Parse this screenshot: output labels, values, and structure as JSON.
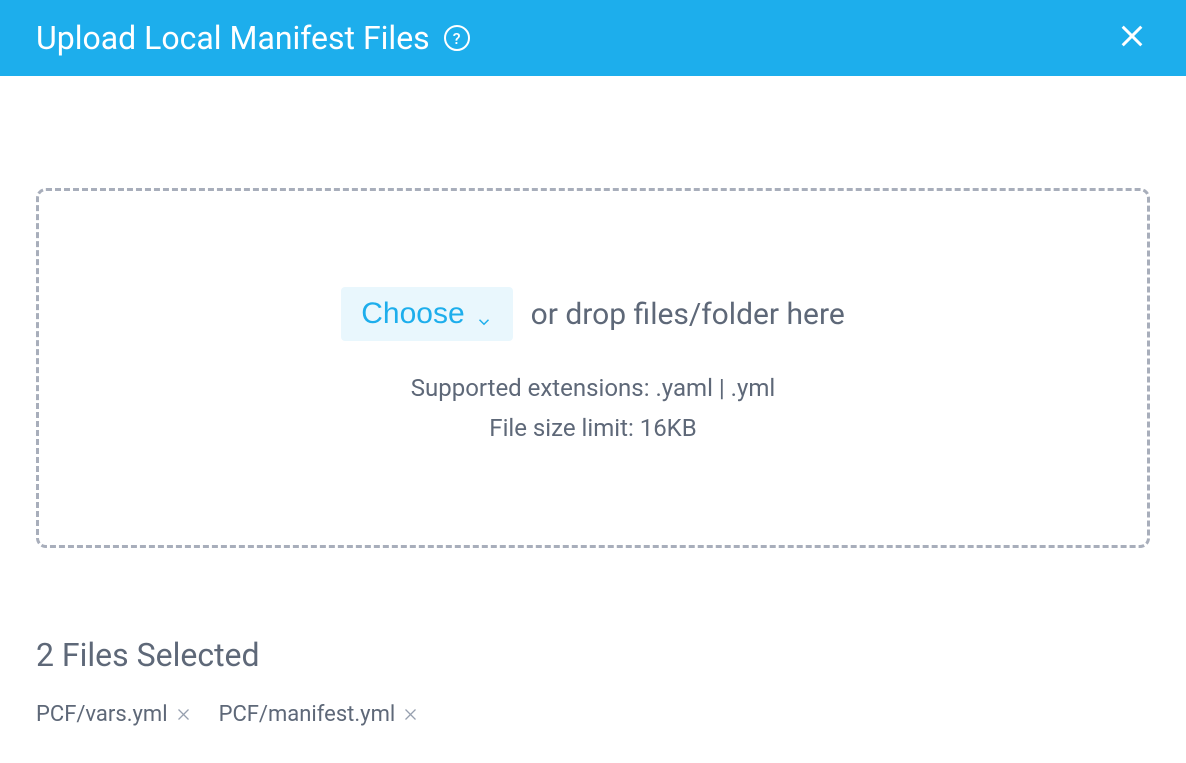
{
  "header": {
    "title": "Upload Local Manifest Files"
  },
  "dropzone": {
    "choose_label": "Choose",
    "drop_text": "or drop files/folder here",
    "extensions_hint": "Supported extensions: .yaml | .yml",
    "size_hint": "File size limit: 16KB"
  },
  "selected": {
    "title": "2 Files Selected",
    "files": [
      {
        "name": "PCF/vars.yml"
      },
      {
        "name": "PCF/manifest.yml"
      }
    ]
  }
}
